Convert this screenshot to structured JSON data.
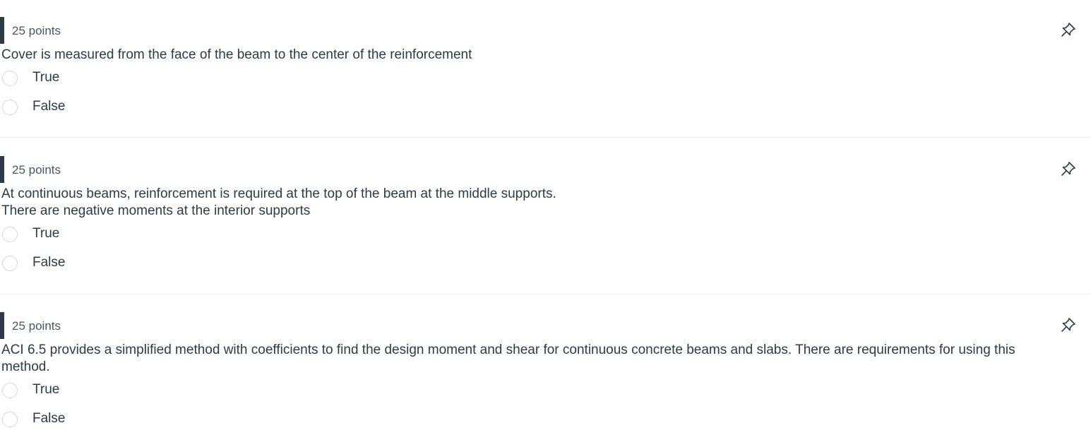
{
  "questions": [
    {
      "points": "25 points",
      "text": "Cover is measured from the face of the beam to the center of the reinforcement",
      "answers": [
        "True",
        "False"
      ]
    },
    {
      "points": "25 points",
      "text_line1": "At continuous beams, reinforcement is required at the top of the beam at the middle supports.",
      "text_line2": "There are negative moments at the interior supports",
      "answers": [
        "True",
        "False"
      ]
    },
    {
      "points": "25 points",
      "text": "ACI 6.5 provides a simplified method with coefficients to find the design moment and shear for continuous concrete beams and slabs.  There are requirements for using this method.",
      "answers": [
        "True",
        "False"
      ]
    }
  ],
  "icons": {
    "pin": "pin-icon",
    "radio": "radio-unselected"
  },
  "colors": {
    "text": "#2d3b45",
    "points_bar": "#2d3b45",
    "radio_border": "#d4d8dc",
    "divider": "#eef0f2"
  }
}
